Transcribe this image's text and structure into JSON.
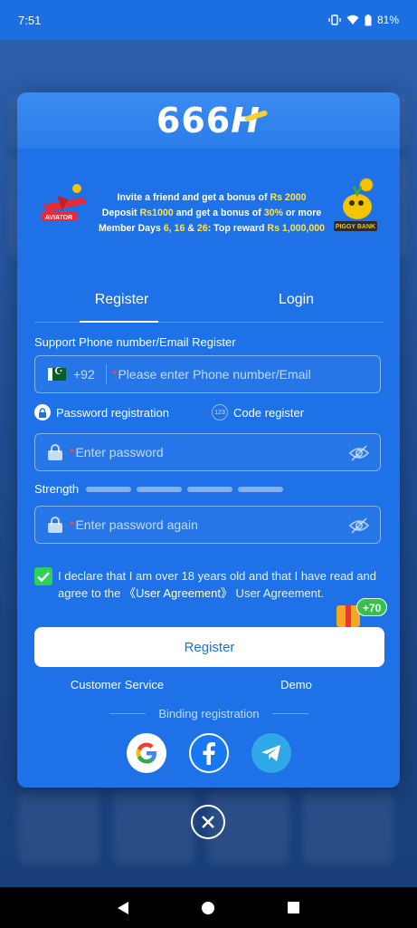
{
  "status_bar": {
    "time": "7:51",
    "battery": "81%"
  },
  "logo": {
    "text": "666",
    "suffix": "H"
  },
  "banner": {
    "aviator_label": "AVIATOR",
    "piggy_label": "PIGGY BANK",
    "line1_a": "Invite a friend and get a bonus of ",
    "line1_b": "Rs 2000",
    "line2_a": "Deposit ",
    "line2_b": "Rs1000",
    "line2_c": " and get a bonus of ",
    "line2_d": "30%",
    "line2_e": " or more",
    "line3_a": "Member Days ",
    "line3_b": "6, 16",
    "line3_c": " & ",
    "line3_d": "26",
    "line3_e": ": Top reward ",
    "line3_f": "Rs 1,000,000"
  },
  "tabs": [
    {
      "label": "Register"
    },
    {
      "label": "Login"
    }
  ],
  "form": {
    "section_label": "Support Phone number/Email Register",
    "country_code": "+92",
    "phone_placeholder": "Please enter Phone number/Email",
    "option_password": "Password registration",
    "option_code_badge": "123",
    "option_code": "Code register",
    "password_placeholder": "Enter password",
    "strength_label": "Strength",
    "password_again_placeholder": "Enter password again",
    "declare_text": "I declare that I am over 18 years old and that I have read and agree to the ",
    "agreement_link": "《User Agreement》",
    "declare_end": " User Agreement.",
    "gift_bonus": "+70",
    "register_button": "Register"
  },
  "links": {
    "customer_service": "Customer Service",
    "demo": "Demo"
  },
  "binding_label": "Binding registration",
  "colors": {
    "modal_bg": "#1e71e6",
    "accent_yellow": "#ffe34a",
    "check_green": "#2ed158",
    "required_red": "#ff4d4d"
  }
}
